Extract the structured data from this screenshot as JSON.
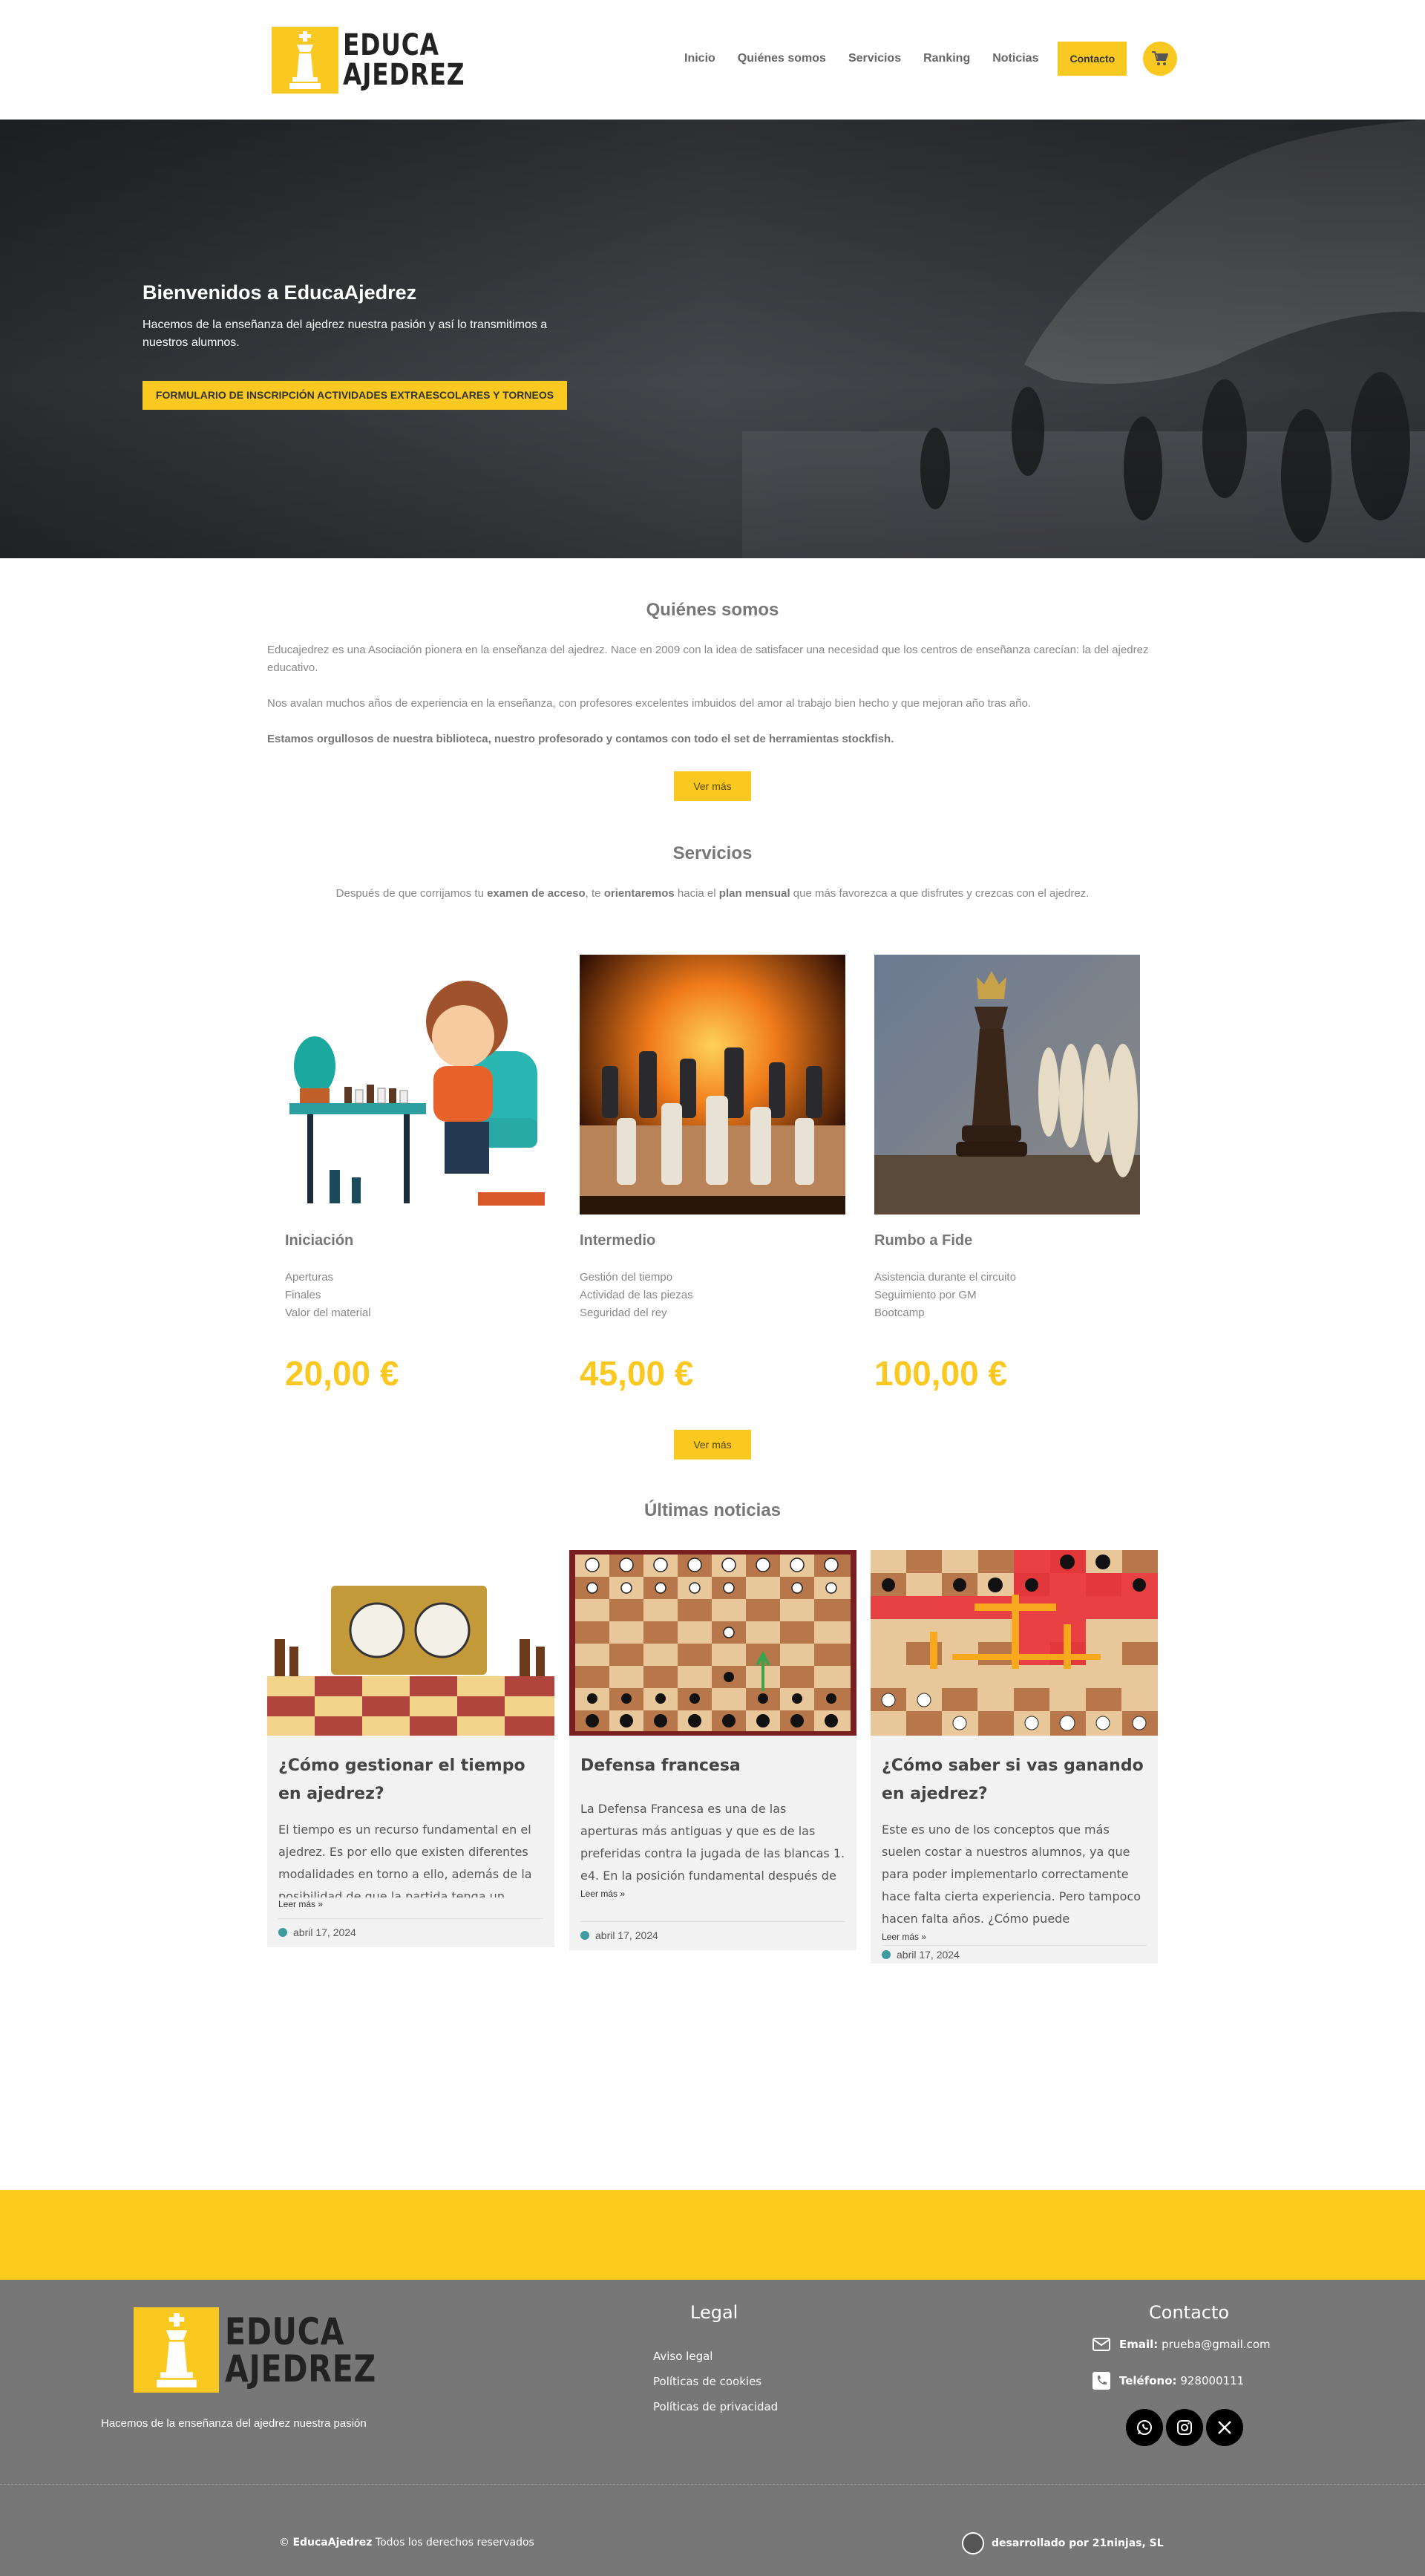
{
  "brand": {
    "line1": "EDUCA",
    "line2": "AJEDREZ",
    "accent_color": "#f9c922"
  },
  "nav": {
    "items": [
      "Inicio",
      "Quiénes somos",
      "Servicios",
      "Ranking",
      "Noticias"
    ],
    "contact": "Contacto",
    "cart_icon": "cart-icon"
  },
  "hero": {
    "title": "Bienvenidos a EducaAjedrez",
    "subtitle": "Hacemos de la enseñanza del ajedrez nuestra pasión y así lo transmitimos a nuestros alumnos.",
    "button": "FORMULARIO DE INSCRIPCIÓN ACTIVIDADES EXTRAESCOLARES Y TORNEOS"
  },
  "about": {
    "title": "Quiénes somos",
    "p1": "Educajedrez es una Asociación pionera en la enseñanza del ajedrez. Nace en 2009 con la idea de satisfacer una necesidad que los centros de enseñanza carecían: la del ajedrez educativo.",
    "p2": "Nos avalan muchos años de experiencia en la enseñanza, con profesores excelentes imbuidos del amor al trabajo bien hecho y que mejoran año tras año.",
    "p3": "Estamos orgullosos de nuestra biblioteca, nuestro profesorado y contamos con todo el set de herramientas stockfish.",
    "button": "Ver más"
  },
  "services": {
    "title": "Servicios",
    "intro_a": "Después de que corrijamos tu ",
    "intro_b": "examen de acceso",
    "intro_c": ", te ",
    "intro_d": "orientaremos",
    "intro_e": " hacia el ",
    "intro_f": "plan mensual",
    "intro_g": " que más favorezca a que disfrutes y crezcas con el ajedrez.",
    "cards": [
      {
        "name": "Iniciación",
        "items": [
          "Aperturas",
          "Finales",
          "Valor del material"
        ],
        "price": "20,00 €"
      },
      {
        "name": "Intermedio",
        "items": [
          "Gestión del tiempo",
          "Actividad de las piezas",
          "Seguridad del rey"
        ],
        "price": "45,00 €"
      },
      {
        "name": "Rumbo a Fide",
        "items": [
          "Asistencia durante el circuito",
          "Seguimiento por GM",
          "Bootcamp"
        ],
        "price": "100,00 €"
      }
    ],
    "button": "Ver más"
  },
  "news": {
    "title": "Últimas noticias",
    "items": [
      {
        "title": "¿Cómo gestionar el tiempo en ajedrez?",
        "text": "El tiempo es un recurso fundamental en el ajedrez. Es por ello que existen diferentes modalidades en torno a ello, además de la posibilidad de que la partida tenga un",
        "more": "Leer más »",
        "date": "abril 17, 2024"
      },
      {
        "title": "Defensa francesa",
        "text": "La Defensa Francesa es una de las aperturas más antiguas y que es de las preferidas contra la jugada de las blancas 1. e4.  En la posición fundamental después de",
        "more": "Leer más »",
        "date": "abril 17, 2024"
      },
      {
        "title": "¿Cómo saber si vas ganando en ajedrez?",
        "text": "Este es uno de los conceptos que más suelen costar a nuestros alumnos, ya que para poder implementarlo correctamente hace falta cierta experiencia. Pero tampoco hacen falta años. ¿Cómo puede",
        "more": "Leer más »",
        "date": "abril 17, 2024"
      }
    ]
  },
  "footer": {
    "tagline": "Hacemos de la enseñanza del ajedrez nuestra pasión",
    "legal_title": "Legal",
    "legal_links": [
      "Aviso legal",
      "Políticas de cookies",
      "Políticas de privacidad"
    ],
    "contact_title": "Contacto",
    "email_label": "Email:",
    "email": "prueba@gmail.com",
    "phone_label": "Teléfono:",
    "phone": "928000111",
    "copyright_symbol": "©",
    "copyright_brand": "EducaAjedrez",
    "copyright_text": "Todos los derechos reservados",
    "developer": "desarrollado por 21ninjas, SL"
  }
}
